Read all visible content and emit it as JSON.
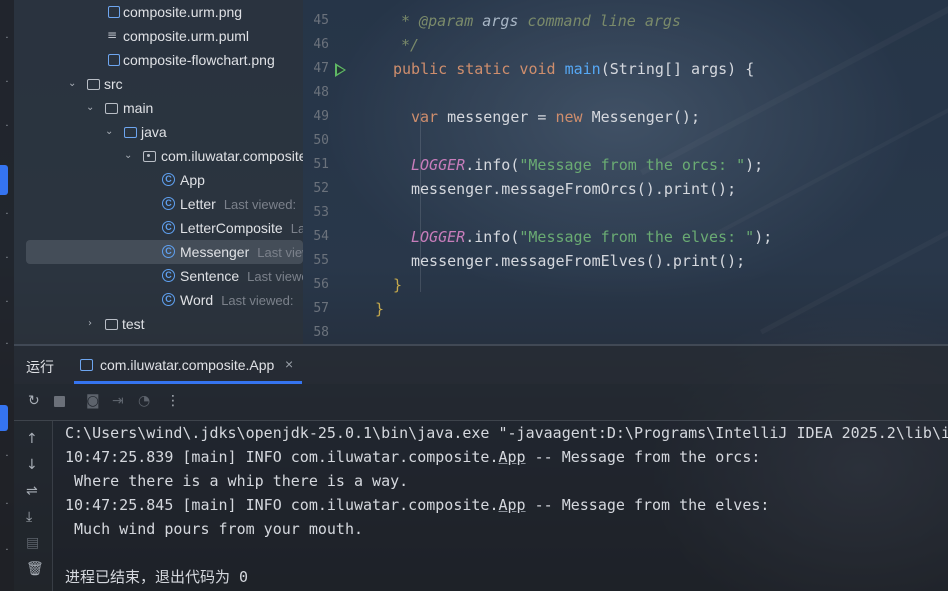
{
  "tree": {
    "items": [
      {
        "label": "composite.urm.png",
        "icon": "image-file-icon"
      },
      {
        "label": "composite.urm.puml",
        "icon": "text-file-icon"
      },
      {
        "label": "composite-flowchart.png",
        "icon": "image-file-icon"
      },
      {
        "label": "src",
        "icon": "folder-icon"
      },
      {
        "label": "main",
        "icon": "folder-icon"
      },
      {
        "label": "java",
        "icon": "source-folder-icon"
      },
      {
        "label": "com.iluwatar.composite",
        "icon": "package-icon"
      },
      {
        "label": "App",
        "hint": "",
        "icon": "class-icon"
      },
      {
        "label": "Letter",
        "hint": "Last viewed: ",
        "icon": "class-icon"
      },
      {
        "label": "LetterComposite",
        "hint": "La",
        "icon": "class-icon"
      },
      {
        "label": "Messenger",
        "hint": "Last view",
        "icon": "class-icon"
      },
      {
        "label": "Sentence",
        "hint": "Last viewe",
        "icon": "class-icon"
      },
      {
        "label": "Word",
        "hint": "Last viewed: ",
        "icon": "class-icon"
      },
      {
        "label": "test",
        "icon": "folder-icon"
      }
    ]
  },
  "editor": {
    "line_numbers": [
      "45",
      "46",
      "47",
      "48",
      "49",
      "50",
      "51",
      "52",
      "53",
      "54",
      "55",
      "56",
      "57",
      "58"
    ],
    "javadoc_param": "* @param",
    "javadoc_args": "args",
    "javadoc_desc": "command line args",
    "javadoc_end": "*/",
    "l47_kw": "public static void",
    "l47_fn": "main",
    "l47_rest": "(String[] args) {",
    "l49_kw": "var",
    "l49_a": "messenger = ",
    "l49_new": "new",
    "l49_b": "Messenger();",
    "logger": "LOGGER",
    "l51_a": ".info(",
    "l51_str": "\"Message from the orcs: \"",
    "l51_b": ");",
    "l52": "messenger.messageFromOrcs().print();",
    "l54_a": ".info(",
    "l54_str": "\"Message from the elves: \"",
    "l54_b": ");",
    "l55": "messenger.messageFromElves().print();",
    "l56": "}",
    "l57": "}"
  },
  "run": {
    "title": "运行",
    "tab_label": "com.iluwatar.composite.App",
    "tab_close": "×"
  },
  "console": {
    "line1": "C:\\Users\\wind\\.jdks\\openjdk-25.0.1\\bin\\java.exe \"-javaagent:D:\\Programs\\IntelliJ IDEA 2025.2\\lib\\i",
    "line2_a": "10:47:25.839 [main] INFO com.iluwatar.composite.",
    "line2_app": "App",
    "line2_b": " -- Message from the orcs:",
    "line3": " Where there is a whip there is a way.",
    "line4_a": "10:47:25.845 [main] INFO com.iluwatar.composite.",
    "line4_app": "App",
    "line4_b": " -- Message from the elves:",
    "line5": " Much wind pours from your mouth.",
    "exit": "进程已结束，退出代码为 0"
  }
}
